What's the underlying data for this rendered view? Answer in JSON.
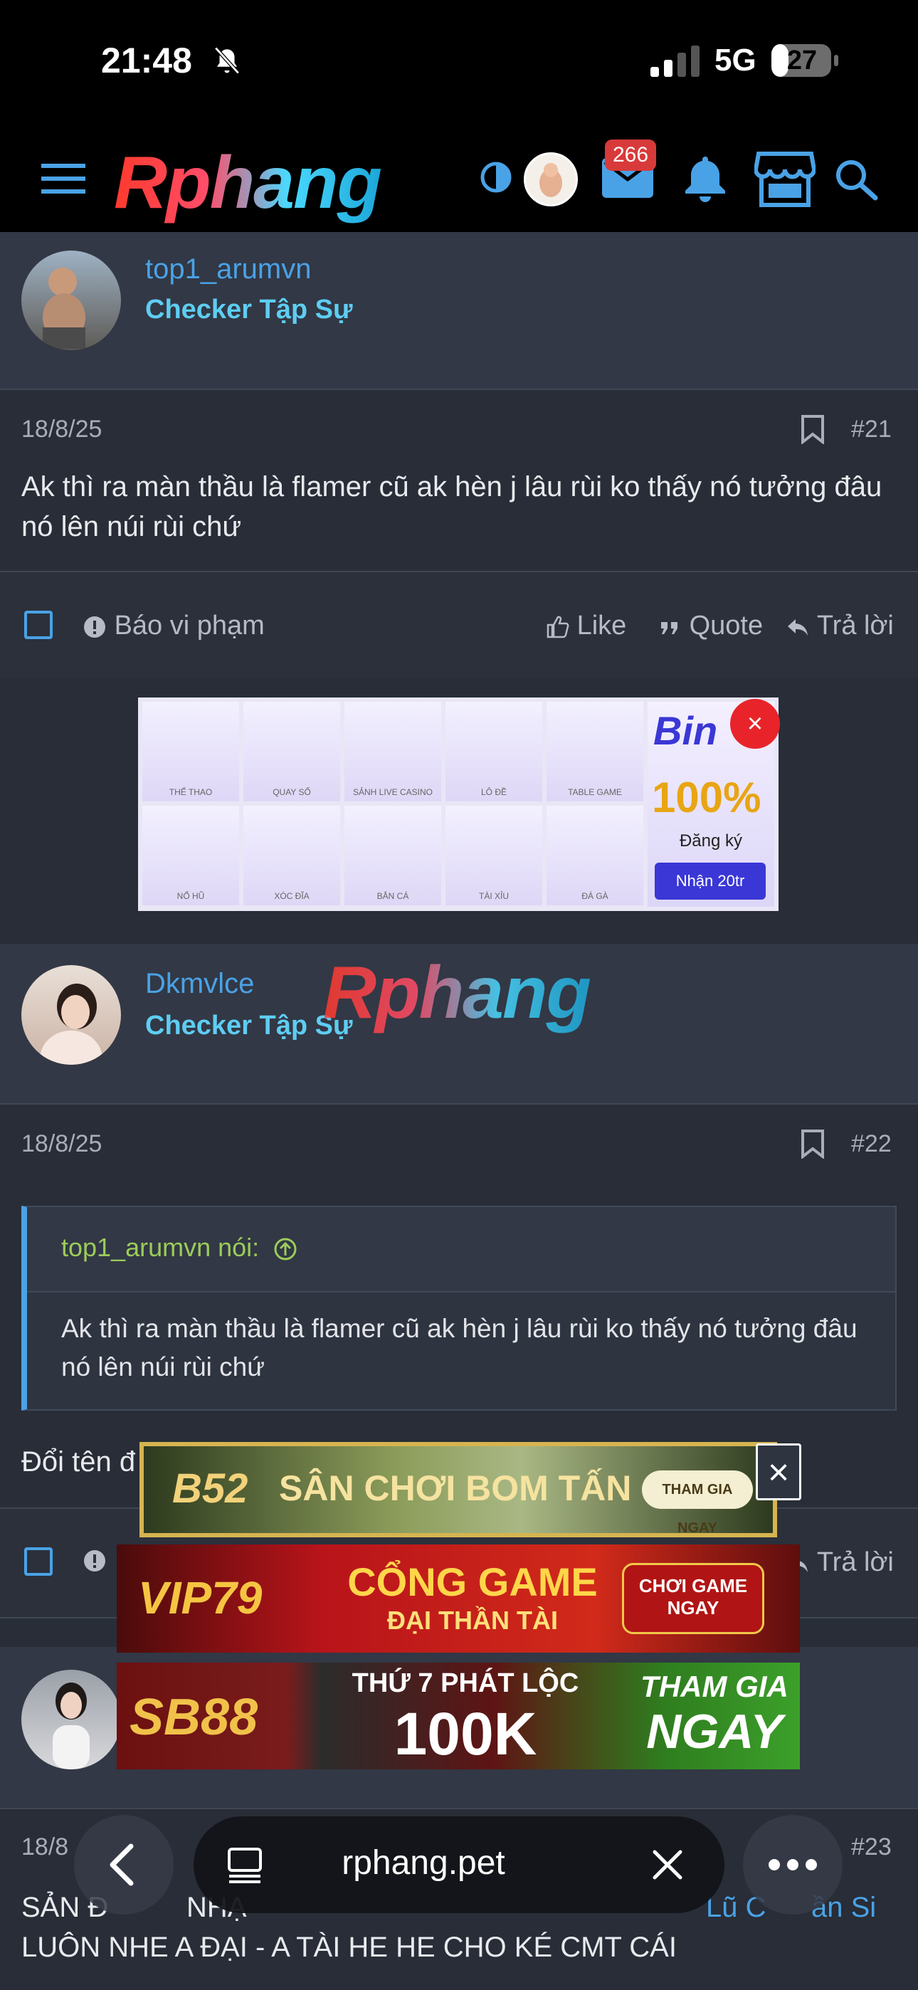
{
  "status_bar": {
    "time": "21:48",
    "network": "5G",
    "battery": "27"
  },
  "header": {
    "logo": "Rphang",
    "mail_badge": "266"
  },
  "posts": [
    {
      "username": "top1_arumvn",
      "rank": "Checker Tập Sự",
      "date": "18/8/25",
      "number": "#21",
      "body": "Ak thì ra màn thầu là flamer cũ ak hèn j lâu rùi ko thấy nó tưởng đâu nó lên núi rùi chứ"
    },
    {
      "username": "Dkmvlce",
      "rank": "Checker Tập Sự",
      "date": "18/8/25",
      "number": "#22",
      "quote_author": "top1_arumvn nói:",
      "quote_body": "Ak thì ra màn thầu là flamer cũ ak hèn j lâu rùi ko thấy nó tưởng đâu nó lên núi rùi chứ",
      "body_partial": "Đổi tên đ"
    },
    {
      "date_partial": "18/8",
      "number": "#23",
      "line1_left": "SẢN Đ",
      "line1_mid": "NHẠ",
      "line1_right": "Lũ C",
      "line1_right2": "ần Si",
      "line2": "LUÔN NHE A ĐẠI - A TÀI HE HE CHO KÉ CMT CÁI"
    }
  ],
  "actions": {
    "report": "Báo vi phạm",
    "like": "Like",
    "quote": "Quote",
    "reply": "Trả lời"
  },
  "ad_casino": {
    "brand": "Bin",
    "bonus": "100%",
    "register": "Đăng ký",
    "cta": "Nhận 20tr",
    "tiles": [
      "THỂ THAO",
      "QUAY SỐ",
      "SẢNH LIVE CASINO",
      "LÔ ĐỀ",
      "TABLE GAME",
      "NỔ HŨ",
      "XÓC ĐĨA",
      "BẮN CÁ",
      "TÀI XỈU",
      "ĐÁ GÀ"
    ]
  },
  "ad_b52": {
    "brand": "B52",
    "headline": "SÂN CHƠI BOM TẤN",
    "cta": "THAM GIA NGAY"
  },
  "ad_vip79": {
    "brand": "VIP79",
    "headline1": "CỔNG GAME",
    "headline2": "ĐẠI THẦN TÀI",
    "cta1": "CHƠI GAME",
    "cta2": "NGAY"
  },
  "ad_sb88": {
    "brand": "SB88",
    "headline1": "THỨ 7 PHÁT LỘC",
    "headline2": "100K",
    "cta1": "THAM GIA",
    "cta2": "NGAY"
  },
  "browser": {
    "url": "rphang.pet"
  },
  "close_glyph": "×"
}
